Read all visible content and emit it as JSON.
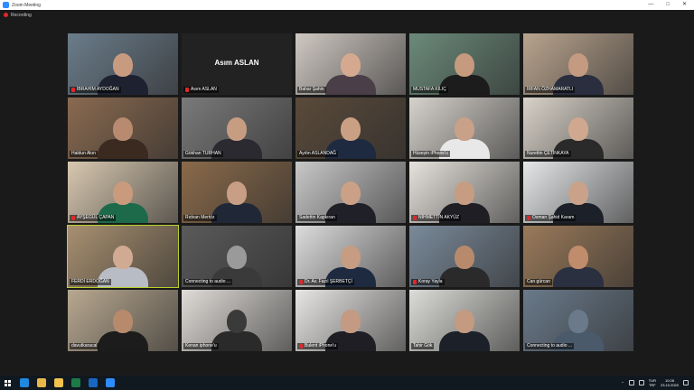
{
  "window": {
    "title": "Zoom Meeting",
    "controls": [
      "—",
      "□",
      "✕"
    ]
  },
  "recording": {
    "label": "Recording"
  },
  "participants": [
    {
      "name": "İBRAHİM AYDOĞAN",
      "muted": true,
      "video": true,
      "bg": "#6b7c8a",
      "skin": "#c89b80",
      "suit": "#1e2230"
    },
    {
      "name": "Asım ASLAN",
      "muted": true,
      "video": false
    },
    {
      "name": "Bahar Şahin",
      "muted": false,
      "video": true,
      "bg": "#cfc8c2",
      "skin": "#d5a98f",
      "suit": "#4a3e48"
    },
    {
      "name": "MUSTAFA KILIÇ",
      "muted": false,
      "video": true,
      "bg": "#6b8a7a",
      "skin": "#c59a7e",
      "suit": "#1c1c1c"
    },
    {
      "name": "İRFAN ÖZHAMARATLI",
      "muted": false,
      "video": true,
      "bg": "#b9a48e",
      "skin": "#c49a80",
      "suit": "#2a2e3e"
    },
    {
      "name": "Haldun Akın",
      "muted": false,
      "video": true,
      "bg": "#8a6a50",
      "skin": "#b88a70",
      "suit": "#3a2a20"
    },
    {
      "name": "Gökhan TURHAN",
      "muted": false,
      "video": true,
      "bg": "#7a7a7a",
      "skin": "#c79d82",
      "suit": "#2a2a30"
    },
    {
      "name": "Aydın ASLANDAĞ",
      "muted": false,
      "video": true,
      "bg": "#5a4a3a",
      "skin": "#caa084",
      "suit": "#1e2a40"
    },
    {
      "name": "Hüseyin iPhone'u",
      "muted": false,
      "video": true,
      "bg": "#d6d2cc",
      "skin": "#c9a088",
      "suit": "#e8e8e8"
    },
    {
      "name": "Nurettin ÇETİNKAYA",
      "muted": false,
      "video": true,
      "bg": "#d8d2c8",
      "skin": "#d0a890",
      "suit": "#2a2a2a"
    },
    {
      "name": "AYŞEGÜL ÇAPAN",
      "muted": true,
      "video": true,
      "bg": "#d8c8b0",
      "skin": "#c99a7c",
      "suit": "#1c6a4a"
    },
    {
      "name": "Rıdvan Mertöz",
      "muted": false,
      "video": true,
      "bg": "#8a6a4a",
      "skin": "#c89e84",
      "suit": "#202838"
    },
    {
      "name": "Sadettin Kapkıran",
      "muted": false,
      "video": true,
      "bg": "#c8c8c8",
      "skin": "#caa086",
      "suit": "#202028"
    },
    {
      "name": "NİHMETTİN AKYÜZ",
      "muted": true,
      "video": true,
      "bg": "#e6e2dc",
      "skin": "#c69c82",
      "suit": "#1e1e24"
    },
    {
      "name": "Osman Şahid Karam",
      "muted": true,
      "video": true,
      "bg": "#e4e6e8",
      "skin": "#caa28a",
      "suit": "#1c2028"
    },
    {
      "name": "FERDİ ERDOĞAN",
      "muted": false,
      "video": true,
      "bg": "#a89070",
      "skin": "#d0aa92",
      "suit": "#b8bcc4",
      "active": true
    },
    {
      "name": "Connecting to audio ...",
      "muted": false,
      "video": true,
      "bg": "#5a5a5a",
      "skin": "#9a9a9a",
      "suit": "#3a3a3a"
    },
    {
      "name": "Dr. Av. Fazıl ŞERBETÇİ",
      "muted": true,
      "video": true,
      "bg": "#dcdcdc",
      "skin": "#c69c82",
      "suit": "#1e2a40"
    },
    {
      "name": "Koray Yayla",
      "muted": true,
      "video": true,
      "bg": "#7a8a9a",
      "skin": "#b88a6c",
      "suit": "#2a2a2a"
    },
    {
      "name": "Can gürcan",
      "muted": false,
      "video": true,
      "bg": "#9a7a5a",
      "skin": "#c08c6c",
      "suit": "#2a3040"
    },
    {
      "name": "davutkaracal",
      "muted": false,
      "video": true,
      "bg": "#b8a890",
      "skin": "#b88a6c",
      "suit": "#1c1c1c"
    },
    {
      "name": "Kenan iphone'u",
      "muted": false,
      "video": true,
      "bg": "#e0dcd8",
      "skin": "#3a3a3a",
      "suit": "#2a2a2a"
    },
    {
      "name": "Bulent iPhone'u",
      "muted": true,
      "video": true,
      "bg": "#e8e6e4",
      "skin": "#c49a82",
      "suit": "#1e1e24"
    },
    {
      "name": "Tahir Gök",
      "muted": false,
      "video": true,
      "bg": "#dcdcd8",
      "skin": "#c49a80",
      "suit": "#1c2028"
    },
    {
      "name": "Connecting to audio ...",
      "muted": false,
      "video": true,
      "bg": "#6a7a8a",
      "skin": "#6a7a8a",
      "suit": "#4a5a6a"
    }
  ],
  "taskbar": {
    "apps": [
      {
        "icon": "edge-icon",
        "color": "#1f8ae0"
      },
      {
        "icon": "chrome-icon",
        "color": "#e8b84a"
      },
      {
        "icon": "explorer-icon",
        "color": "#f2c14e"
      },
      {
        "icon": "excel-icon",
        "color": "#1e7a45"
      },
      {
        "icon": "outlook-icon",
        "color": "#1a66c0"
      },
      {
        "icon": "zoom-icon",
        "color": "#2d8cff"
      }
    ],
    "lang": "TUR",
    "lang2": "TRF",
    "time": "10:28",
    "date": "23.10.2020"
  }
}
